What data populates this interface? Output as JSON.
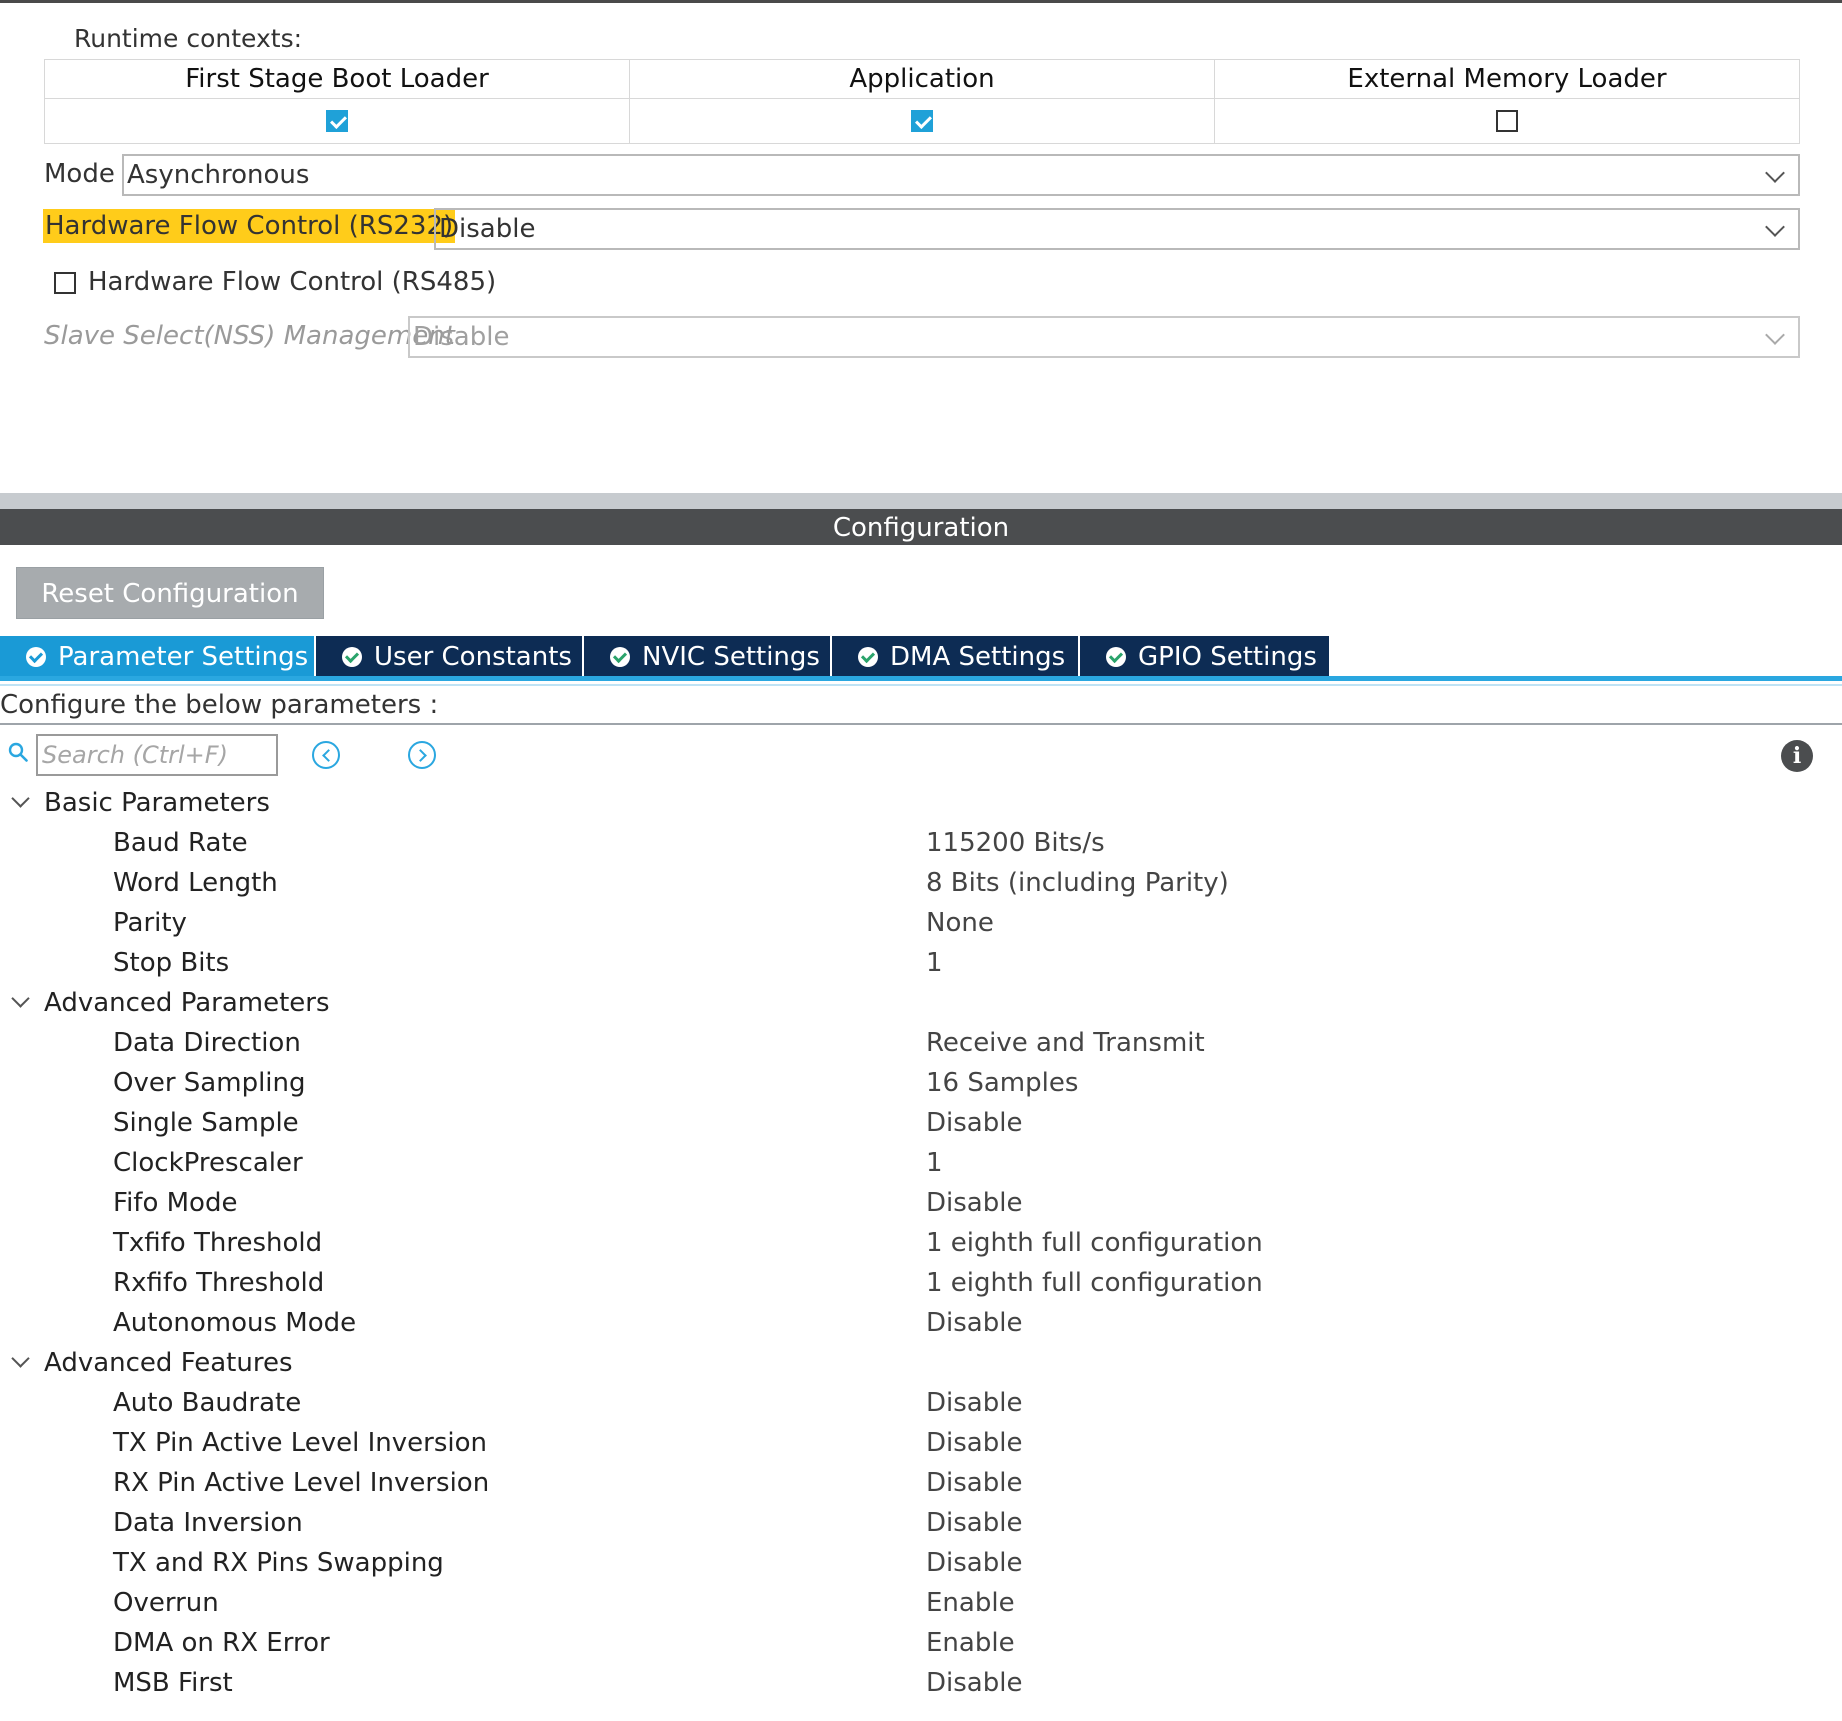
{
  "runtime": {
    "label": "Runtime contexts:",
    "columns": [
      "First Stage Boot Loader",
      "Application",
      "External Memory Loader"
    ],
    "checked": [
      true,
      true,
      false
    ]
  },
  "mode": {
    "label": "Mode",
    "value": "Asynchronous"
  },
  "hw_flow_rs232": {
    "label": "Hardware Flow Control (RS232)",
    "value": "Disable"
  },
  "hw_flow_rs485": {
    "label": "Hardware Flow Control (RS485)",
    "checked": false
  },
  "nss": {
    "label": "Slave Select(NSS) Management",
    "value": "Disable"
  },
  "config": {
    "title": "Configuration",
    "reset_label": "Reset Configuration"
  },
  "tabs": [
    {
      "label": "Parameter Settings",
      "active": true
    },
    {
      "label": "User Constants",
      "active": false
    },
    {
      "label": "NVIC Settings",
      "active": false
    },
    {
      "label": "DMA Settings",
      "active": false
    },
    {
      "label": "GPIO Settings",
      "active": false
    }
  ],
  "configure_label": "Configure the below parameters :",
  "search": {
    "placeholder": "Search (Ctrl+F)"
  },
  "groups": [
    {
      "label": "Basic Parameters",
      "params": [
        {
          "name": "Baud Rate",
          "value": "115200 Bits/s"
        },
        {
          "name": "Word Length",
          "value": "8 Bits (including Parity)"
        },
        {
          "name": "Parity",
          "value": "None"
        },
        {
          "name": "Stop Bits",
          "value": "1"
        }
      ]
    },
    {
      "label": "Advanced Parameters",
      "params": [
        {
          "name": "Data Direction",
          "value": "Receive and Transmit"
        },
        {
          "name": "Over Sampling",
          "value": "16 Samples"
        },
        {
          "name": "Single Sample",
          "value": "Disable"
        },
        {
          "name": "ClockPrescaler",
          "value": "1"
        },
        {
          "name": "Fifo Mode",
          "value": "Disable"
        },
        {
          "name": "Txfifo Threshold",
          "value": "1 eighth full configuration"
        },
        {
          "name": "Rxfifo Threshold",
          "value": "1 eighth full configuration"
        },
        {
          "name": "Autonomous Mode",
          "value": "Disable"
        }
      ]
    },
    {
      "label": "Advanced Features",
      "params": [
        {
          "name": "Auto Baudrate",
          "value": "Disable"
        },
        {
          "name": "TX Pin Active Level Inversion",
          "value": "Disable"
        },
        {
          "name": "RX Pin Active Level Inversion",
          "value": "Disable"
        },
        {
          "name": "Data Inversion",
          "value": "Disable"
        },
        {
          "name": "TX and RX Pins Swapping",
          "value": "Disable"
        },
        {
          "name": "Overrun",
          "value": "Enable"
        },
        {
          "name": "DMA on RX Error",
          "value": "Enable"
        },
        {
          "name": "MSB First",
          "value": "Disable"
        }
      ]
    }
  ],
  "colors": {
    "accent": "#1a9ad6",
    "tab_bg": "#0d2c54",
    "highlight": "#ffcc1a",
    "config_bar": "#4b4d4f"
  },
  "icons": {
    "search": "search-icon",
    "prev": "chevron-left-icon",
    "next": "chevron-right-icon",
    "info": "info-icon",
    "tab_status": "check-circle-icon"
  }
}
